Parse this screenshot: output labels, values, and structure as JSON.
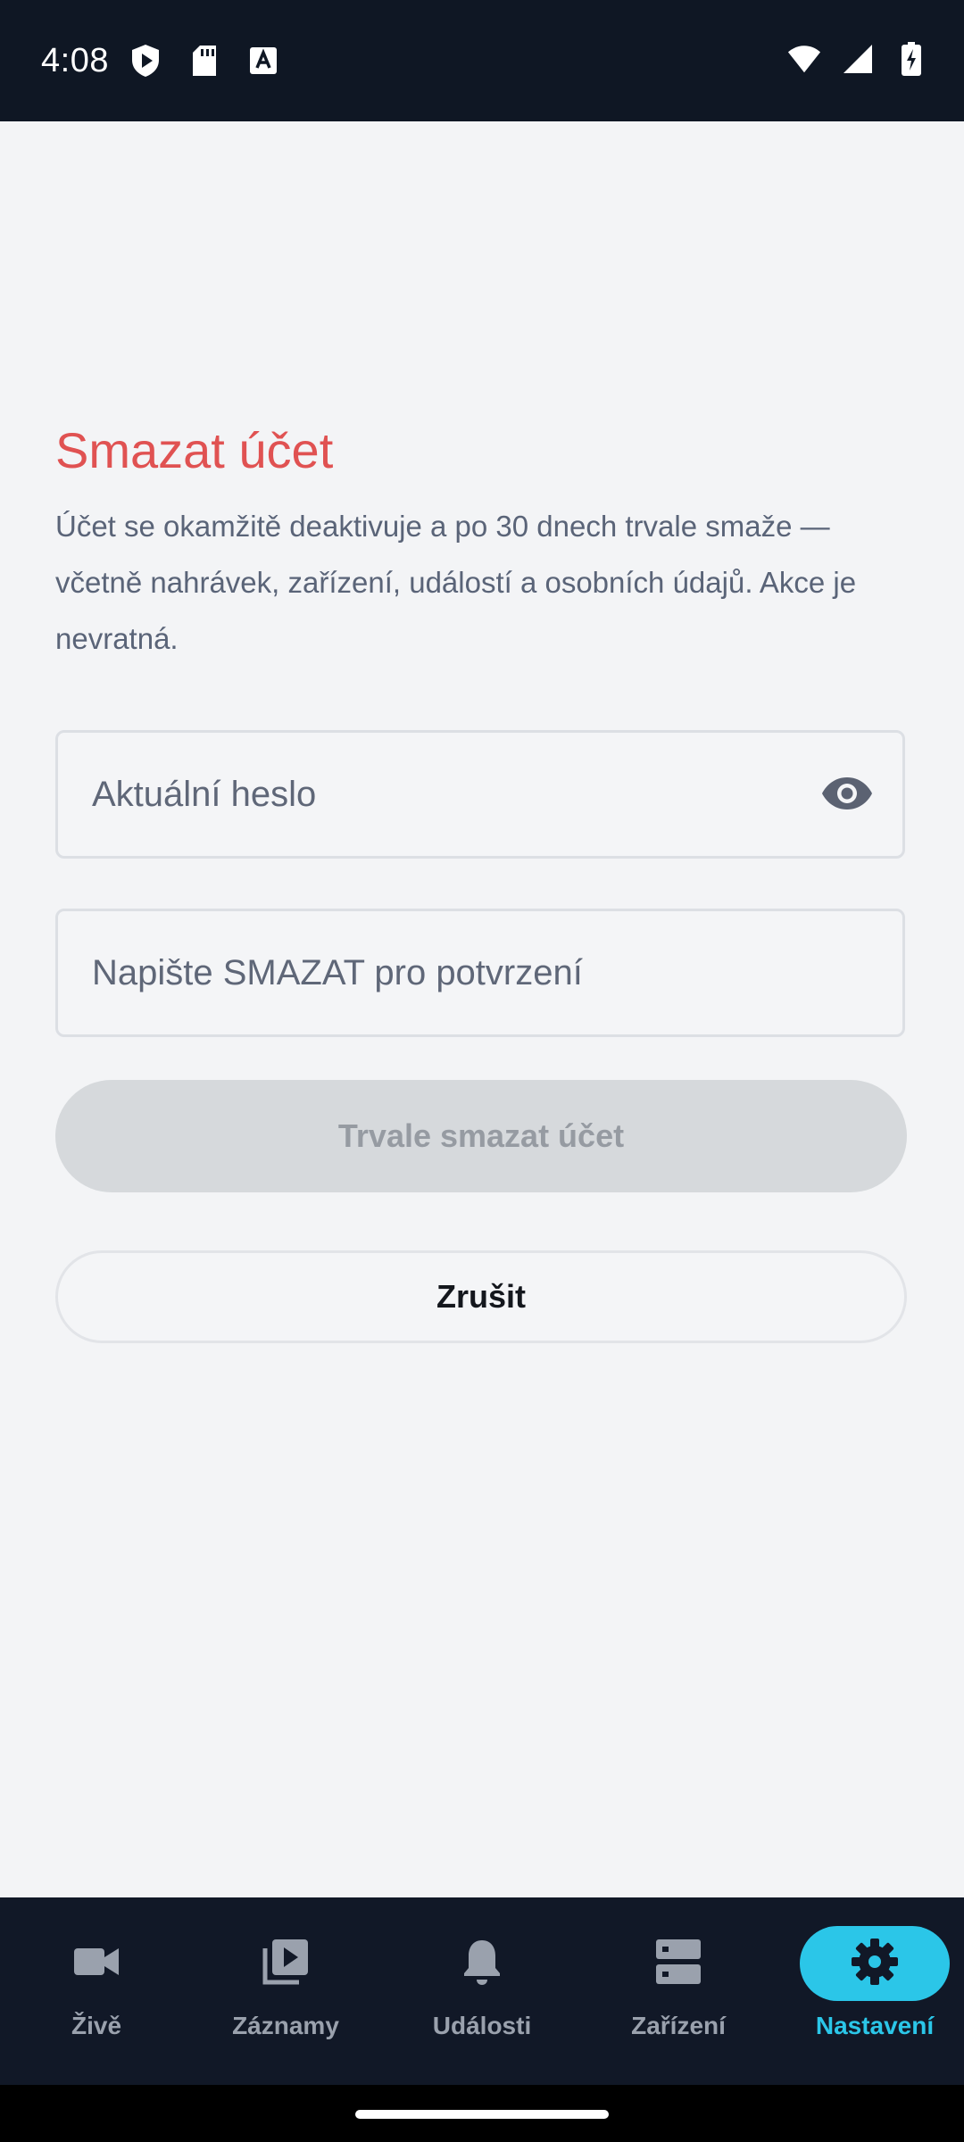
{
  "status_bar": {
    "time": "4:08",
    "left_icons": [
      "shield-play-icon",
      "sd-card-icon",
      "font-a-icon"
    ],
    "right_icons": [
      "wifi-icon",
      "signal-icon",
      "battery-charging-icon"
    ]
  },
  "page": {
    "title": "Smazat účet",
    "description": "Účet se okamžitě deaktivuje a po 30 dnech trvale smaže — včetně nahrávek, zařízení, událostí a osobních údajů. Akce je nevratná.",
    "password_placeholder": "Aktuální heslo",
    "confirm_placeholder": "Napište SMAZAT pro potvrzení",
    "delete_button_label": "Trvale smazat účet",
    "cancel_button_label": "Zrušit"
  },
  "colors": {
    "title": "#e05252",
    "accent": "#2bc6e8",
    "nav_background": "#111827",
    "disabled_button": "#d6d9dc"
  },
  "nav": {
    "items": [
      {
        "label": "Živě",
        "icon": "video-camera-icon",
        "active": false
      },
      {
        "label": "Záznamy",
        "icon": "video-library-icon",
        "active": false
      },
      {
        "label": "Události",
        "icon": "bell-icon",
        "active": false
      },
      {
        "label": "Zařízení",
        "icon": "storage-icon",
        "active": false
      },
      {
        "label": "Nastavení",
        "icon": "gear-icon",
        "active": true
      }
    ]
  }
}
